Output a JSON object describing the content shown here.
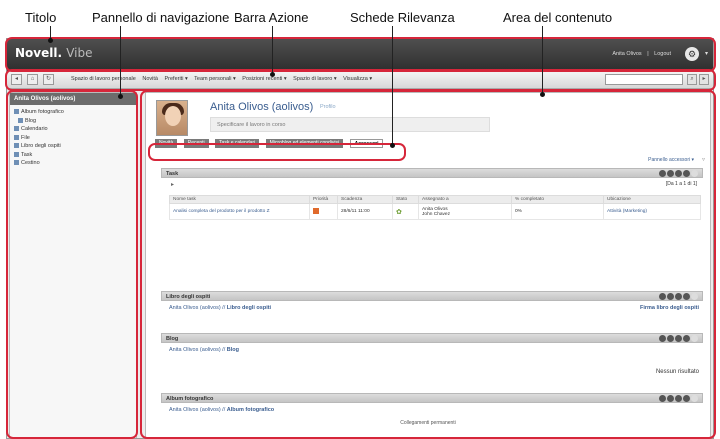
{
  "callouts": {
    "titolo": "Titolo",
    "pannello": "Pannello di navigazione",
    "barra": "Barra Azione",
    "schede": "Schede Rilevanza",
    "area": "Area del contenuto"
  },
  "titlebar": {
    "brand": "Novell.",
    "product": "Vibe",
    "user": "Anita Olivos",
    "separator": "|",
    "logout": "Logout"
  },
  "actionbar": {
    "items": [
      "Spazio di lavoro personale",
      "Novità",
      "Preferiti ▾",
      "Team personali ▾",
      "Posizioni recenti ▾",
      "Spazio di lavoro ▾",
      "Visualizza ▾"
    ]
  },
  "sidebar": {
    "title": "Anita Olivos (aolivos)",
    "items": [
      "Album fotografico",
      "Blog",
      "Calendario",
      "File",
      "Libro degli ospiti",
      "Task",
      "Cestino"
    ]
  },
  "profile": {
    "name": "Anita Olivos (aolivos)",
    "profile_link": "Profilo",
    "status_placeholder": "Specificare il lavoro in corso"
  },
  "tabs": [
    "Novità",
    "Recenti",
    "Task e calendari",
    "Microblog ed elementi condivisi",
    "Accessori"
  ],
  "accessories_link": "Pannello accessori ▾",
  "task_section": {
    "title": "Task",
    "pager": "[Da 1 a 1 di 1]",
    "columns": [
      "Nome task",
      "Priorità",
      "Scadenza",
      "Stato",
      "Assegnato a",
      "% completato",
      "Ubicazione"
    ],
    "row": {
      "name": "Analisi completa del prodotto per il prodotto Z",
      "due": "28/6/11 11:00",
      "assignee1": "Anita Olivos",
      "assignee2": "John Chavez",
      "percent": "0%",
      "location": "Attività (Marketing)"
    }
  },
  "guestbook": {
    "title": "Libro degli ospiti",
    "prefix": "Anita Olivos (aolivos) //",
    "target": "Libro degli ospiti",
    "sign_link": "Firma libro degli ospiti"
  },
  "blog": {
    "title": "Blog",
    "prefix": "Anita Olivos (aolivos) //",
    "target": "Blog",
    "no_results": "Nessun risultato"
  },
  "album": {
    "title": "Album fotografico",
    "prefix": "Anita Olivos (aolivos) //",
    "target": "Album fotografico"
  },
  "footer": "Collegamenti permanenti"
}
